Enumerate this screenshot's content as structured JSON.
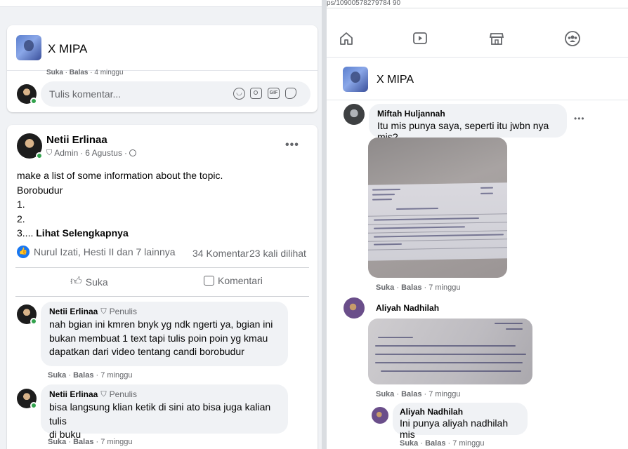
{
  "left": {
    "group_name": "X MIPA",
    "top_meta": {
      "like": "Suka",
      "sep": " · ",
      "reply": "Balas",
      "time": "4 minggu"
    },
    "comment_input": {
      "placeholder": "Tulis komentar..."
    },
    "post": {
      "author": "Netii Erlinaa",
      "role": "Admin",
      "date": "6 Agustus",
      "body_lines": [
        "make a list of some information about the topic.",
        "Borobudur",
        "1.",
        "2.",
        "3...."
      ],
      "see_more": "Lihat Selengkapnya",
      "reactions_text": "Nurul Izati, Hesti II dan 7 lainnya",
      "comments_count": "34 Komentar",
      "views": "23 kali dilihat",
      "like_label": "Suka",
      "comment_label": "Komentari"
    },
    "comments": [
      {
        "author": "Netii Erlinaa",
        "badge": "Penulis",
        "lines": [
          "nah bgian ini kmren bnyk yg ndk ngerti ya, bgian ini",
          "bukan membuat 1 text tapi tulis poin poin yg kmau",
          "dapatkan dari video tentang candi borobudur"
        ],
        "like": "Suka",
        "reply": "Balas",
        "time": "7 minggu"
      },
      {
        "author": "Netii Erlinaa",
        "badge": "Penulis",
        "lines": [
          "bisa langsung klian ketik di sini ato bisa juga kalian tulis",
          "di buku"
        ],
        "like": "Suka",
        "reply": "Balas",
        "time": "7 minggu"
      }
    ]
  },
  "right": {
    "url_fragment": "ps/10900578279784 90",
    "nav_icons": [
      "home-icon",
      "watch-icon",
      "marketplace-icon",
      "groups-icon"
    ],
    "group_name": "X MIPA",
    "comments": [
      {
        "author": "Miftah Huljannah",
        "text": "Itu mis punya saya, seperti itu jwbn nya mis?",
        "like": "Suka",
        "reply": "Balas",
        "time": "7 minggu"
      },
      {
        "author": "Aliyah Nadhilah",
        "like": "Suka",
        "reply": "Balas",
        "time": "7 minggu"
      },
      {
        "author": "Aliyah Nadhilah",
        "text": "Ini punya aliyah nadhilah mis",
        "like": "Suka",
        "reply": "Balas",
        "time": "7 minggu"
      }
    ]
  },
  "colors": {
    "accent": "#1877f2",
    "online": "#31a24c",
    "muted": "#65676b",
    "bubble": "#f0f2f5"
  }
}
